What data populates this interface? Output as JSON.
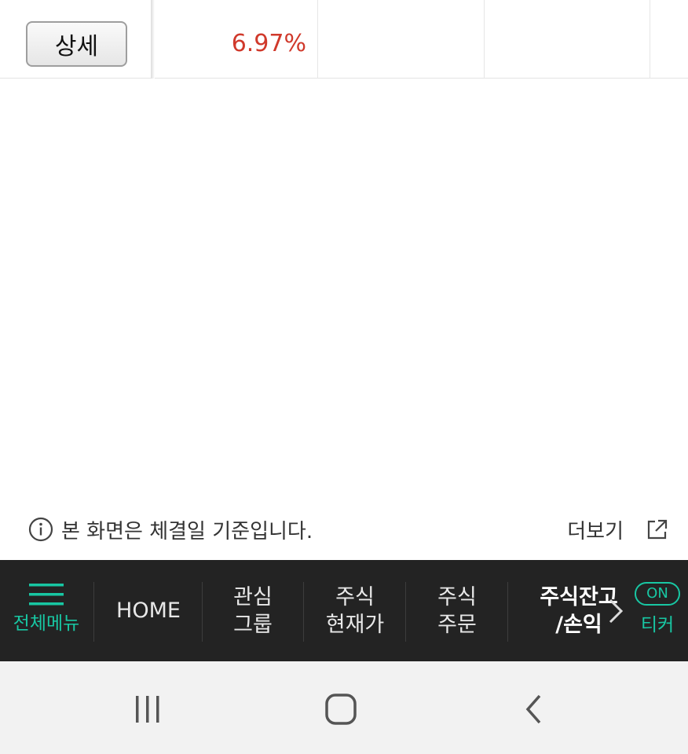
{
  "table": {
    "detail_label": "상세",
    "rate": "6.97%"
  },
  "notice": {
    "text": "본 화면은 체결일 기준입니다.",
    "more_label": "더보기"
  },
  "bottom_nav": {
    "menu_label": "전체메뉴",
    "home_label": "HOME",
    "watch_line1": "관심",
    "watch_line2": "그룹",
    "price_line1": "주식",
    "price_line2": "현재가",
    "order_line1": "주식",
    "order_line2": "주문",
    "balance_line1": "주식잔고",
    "balance_line2": "/손익",
    "ticker_badge": "ON",
    "ticker_label": "티커"
  },
  "colors": {
    "accent": "#18c7a3",
    "rate_up": "#d0392b",
    "nav_bg": "#232323"
  }
}
